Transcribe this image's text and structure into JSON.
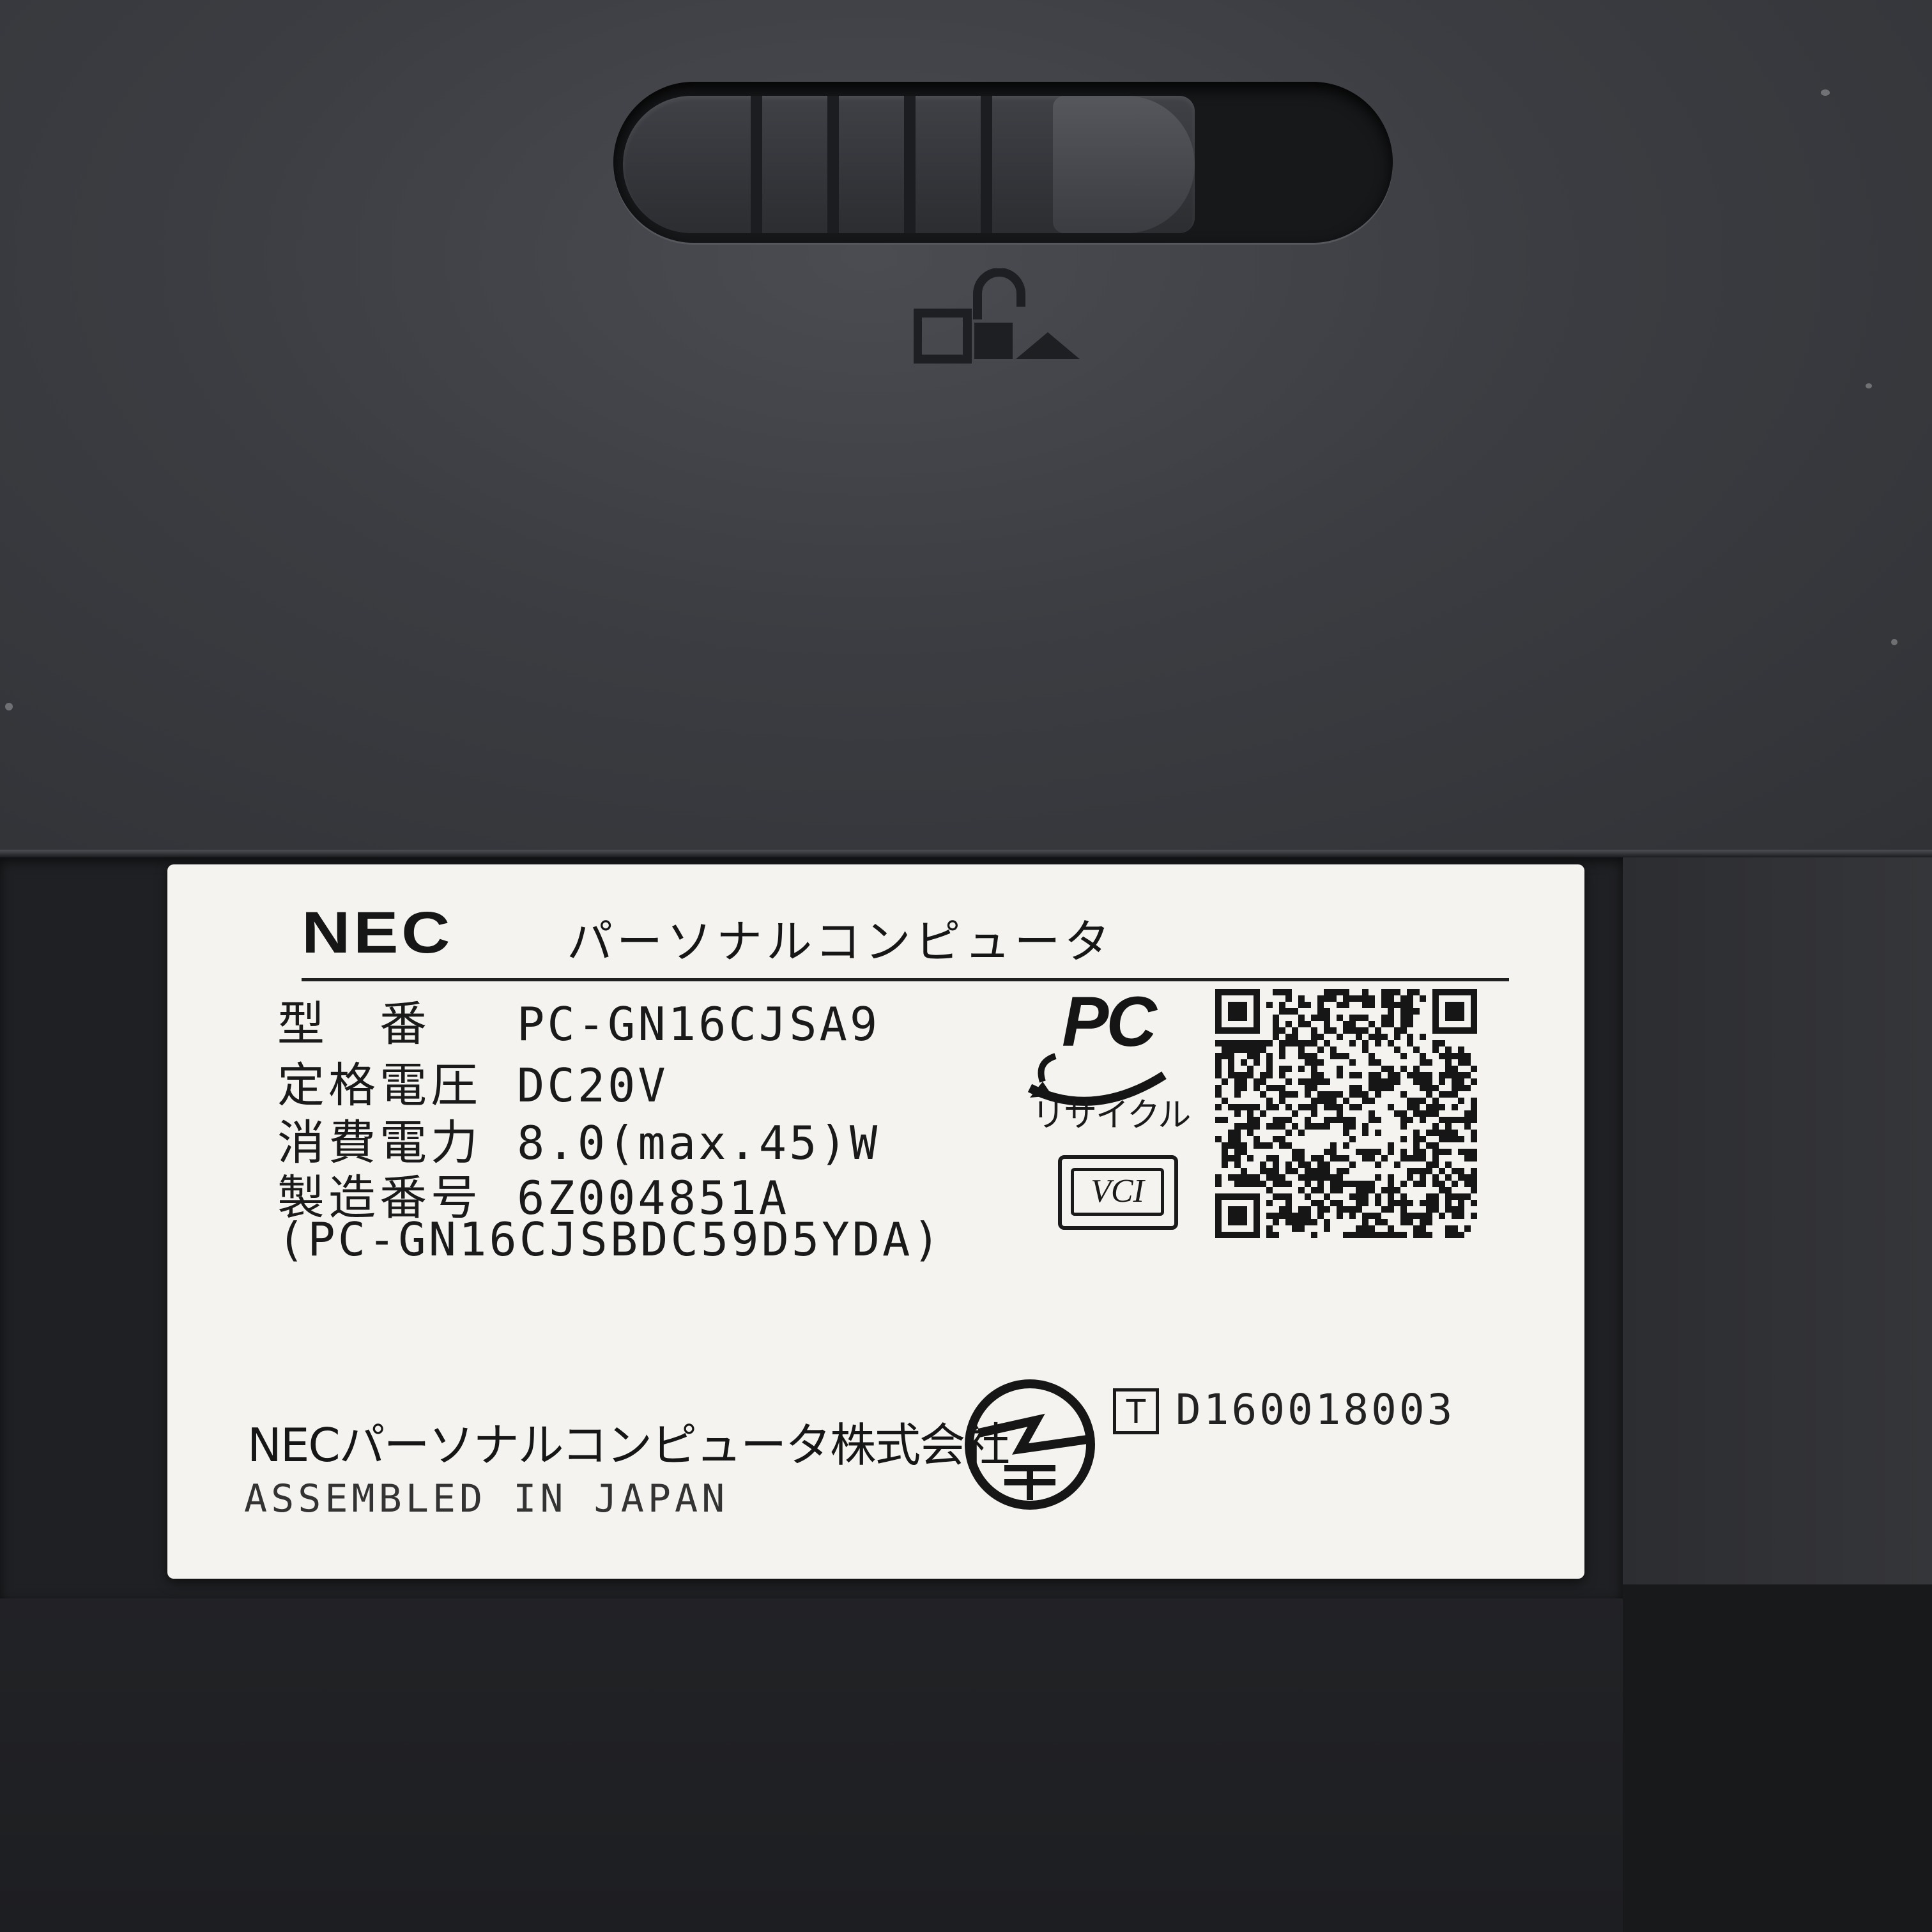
{
  "label": {
    "brand": "NEC",
    "subtitle": "パーソナルコンピュータ",
    "specs": [
      {
        "key": "型　番",
        "value": "PC-GN16CJSA9"
      },
      {
        "key": "定格電圧",
        "value": "DC20V"
      },
      {
        "key": "消費電力",
        "value": "8.0(max.45)W"
      },
      {
        "key": "製造番号",
        "value": "6Z004851A"
      }
    ],
    "serial_extended": "(PC-GN16CJSBDC59D5YDA)",
    "pc_recycle_mark": "PC",
    "recycle_text": "リサイクル",
    "vcci_mark": "VCI",
    "company": "NECパーソナルコンピュータ株式会社",
    "assembled": "ASSEMBLED IN JAPAN",
    "telec_symbol": "T",
    "telec_code": "D160018003"
  },
  "colors": {
    "shell_dark": "#2e2f32",
    "sticker": "#f4f3ef",
    "ink": "#161616"
  },
  "icons": [
    "battery-latch",
    "unlock-icon",
    "pc-recycle-icon",
    "vcci-icon",
    "qr-code",
    "giteki-mark-icon"
  ]
}
